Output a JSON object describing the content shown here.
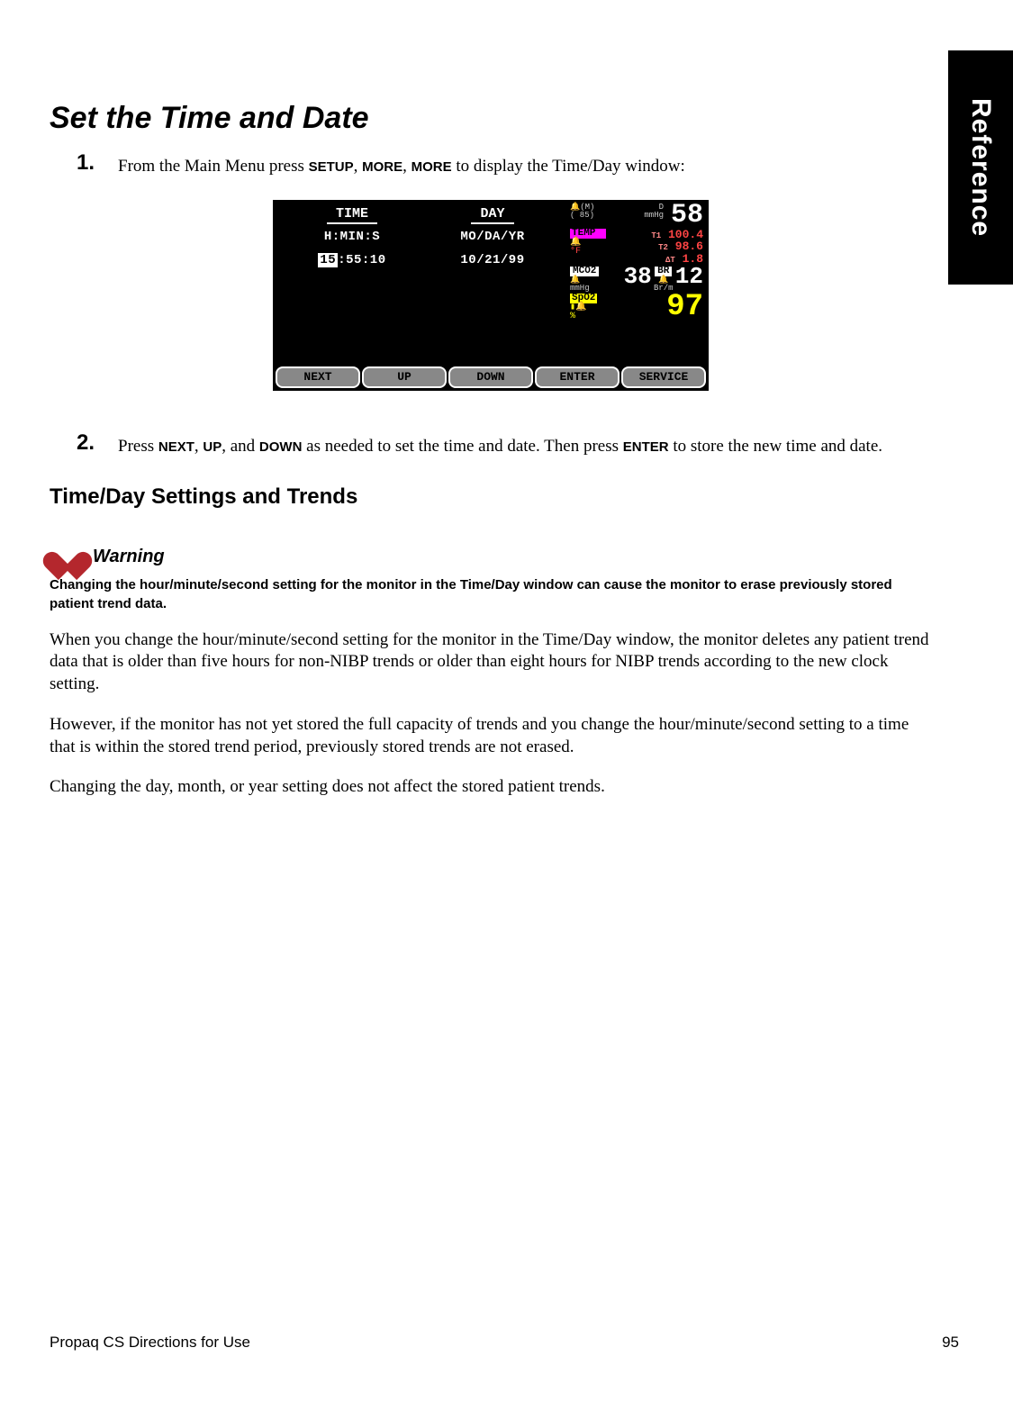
{
  "sideTab": "Reference",
  "h1": "Set the Time and Date",
  "step1": {
    "num": "1.",
    "pre": "From the Main Menu press ",
    "k1": "SETUP",
    "c1": ", ",
    "k2": "MORE",
    "c2": ", ",
    "k3": "MORE",
    "post": " to display the Time/Day window:"
  },
  "screen": {
    "colA": {
      "head": "TIME",
      "sub": "H:MIN:S",
      "cursor": "15",
      "rest": ":55:10"
    },
    "colB": {
      "head": "DAY",
      "sub": "MO/DA/YR",
      "val": "10/21/99"
    },
    "nibp": {
      "m": "(M)",
      "mean": "( 85)",
      "d": "D",
      "unit": "mmHg",
      "val": "58"
    },
    "temp": {
      "label": "TEMP",
      "unit": "°F",
      "t1l": "T1",
      "t1": "100.4",
      "t2l": "T2",
      "t2": "98.6",
      "dtl": "ΔT",
      "dt": "1.8"
    },
    "co2": {
      "label": "MCO2",
      "unit": "mmHg",
      "val": "38"
    },
    "br": {
      "label": "BR",
      "unit": "Br/m",
      "val": "12"
    },
    "spo2": {
      "label": "SpO2",
      "unit": "%",
      "val": "97"
    },
    "buttons": [
      "NEXT",
      "UP",
      "DOWN",
      "ENTER",
      "SERVICE"
    ]
  },
  "step2": {
    "num": "2.",
    "t1": "Press ",
    "k1": "NEXT",
    "c1": ", ",
    "k2": "UP",
    "c2": ", and ",
    "k3": "DOWN",
    "t2": " as needed to set the time and date. Then press ",
    "k4": "ENTER",
    "t3": " to store the new time and date."
  },
  "h2": "Time/Day Settings and Trends",
  "warnLabel": "Warning",
  "warnText": "Changing the hour/minute/second setting for the monitor in the Time/Day window can cause the monitor to erase previously stored patient trend data.",
  "p1": "When you change the hour/minute/second setting for the monitor in the Time/Day window, the monitor deletes any patient trend data that is older than five hours for non-NIBP trends or older than eight hours for NIBP trends according to the new clock setting.",
  "p2": "However, if the monitor has not yet stored the full capacity of trends and you change the hour/minute/second setting to a time that is within the stored trend period, previously stored trends are not erased.",
  "p3": "Changing the day, month, or year setting does not affect the stored patient trends.",
  "footerLeft": "Propaq CS Directions for Use",
  "footerRight": "95"
}
